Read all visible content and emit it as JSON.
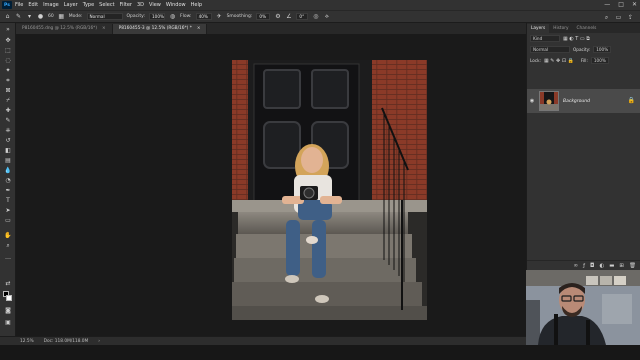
{
  "app": {
    "logo_text": "Ps"
  },
  "menu": [
    "File",
    "Edit",
    "Image",
    "Layer",
    "Type",
    "Select",
    "Filter",
    "3D",
    "View",
    "Window",
    "Help"
  ],
  "window_controls": {
    "minimize": "—",
    "maximize": "□",
    "close": "✕"
  },
  "options": {
    "brush_size": "60",
    "mode_label": "Mode:",
    "mode_value": "Normal",
    "opacity_label": "Opacity:",
    "opacity_value": "100%",
    "flow_label": "Flow:",
    "flow_value": "40%",
    "smoothing_label": "Smoothing:",
    "smoothing_value": "0%",
    "angle_value": "0°"
  },
  "tabs": [
    {
      "label": "P8160455.dng @ 12.5% (RGB/16*)",
      "close": "×"
    },
    {
      "label": "P8160455-3 @ 12.5% (RGB/16*) *",
      "close": "×"
    }
  ],
  "status": {
    "zoom": "12.5%",
    "doc": "Doc: 118.0M/118.0M",
    "arrow": "›"
  },
  "panels": {
    "tabs": [
      "Layers",
      "History",
      "Channels"
    ],
    "search_kind": "Kind",
    "blend_mode": "Normal",
    "opacity_label": "Opacity:",
    "opacity_value": "100%",
    "lock_label": "Lock:",
    "fill_label": "Fill:",
    "fill_value": "100%",
    "layer_name": "Background"
  },
  "colors": {
    "accent": "#31a8ff",
    "panel": "#323232",
    "canvas": "#1a1a1a"
  }
}
